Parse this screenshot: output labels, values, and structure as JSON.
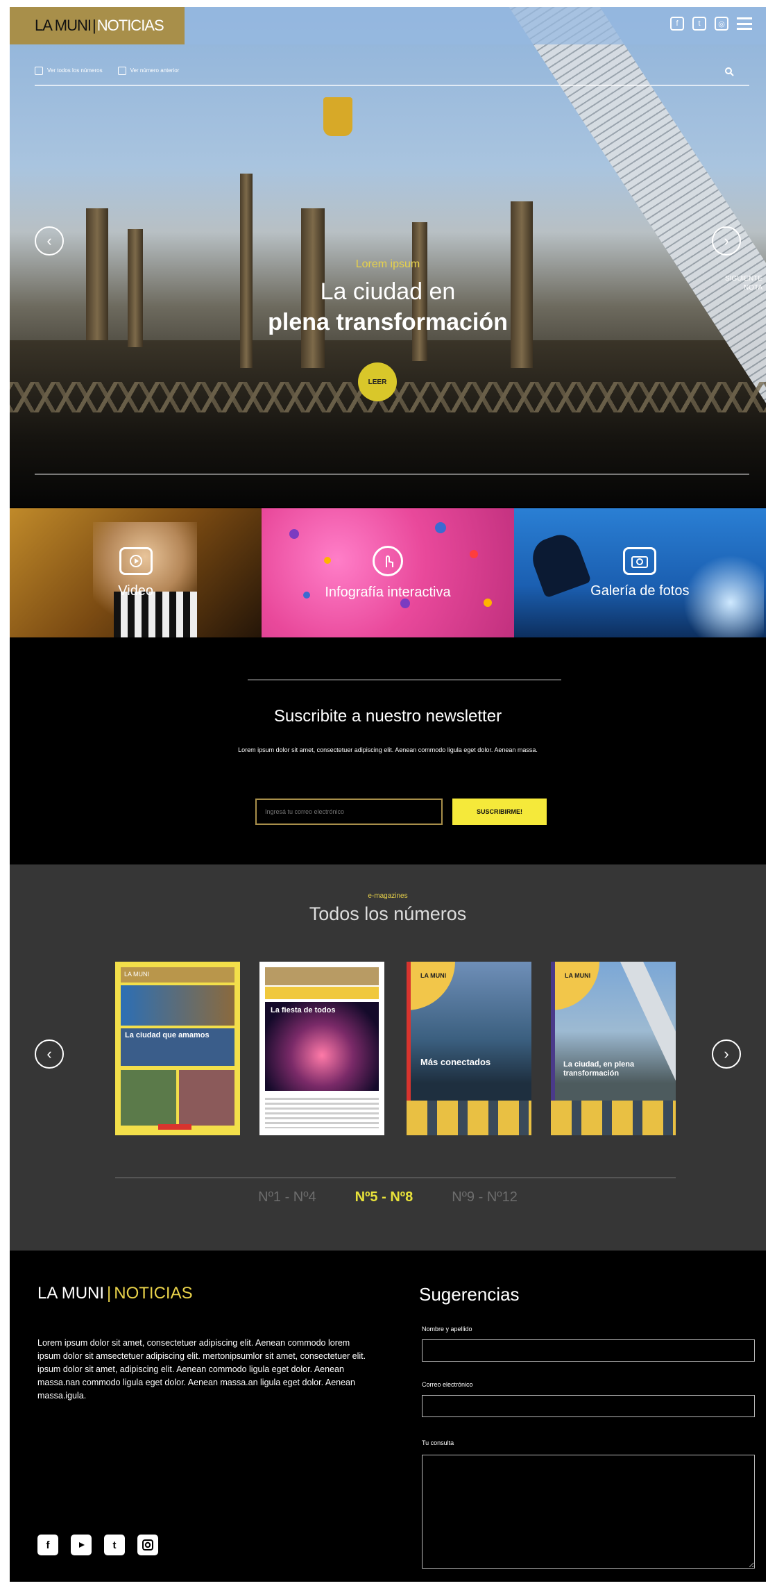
{
  "header": {
    "logo_main": "LA MUNI",
    "logo_sep": "|",
    "logo_sub": "NOTICIAS",
    "subnav": [
      "Ver todos los números",
      "Ver número anterior"
    ]
  },
  "hero": {
    "kicker": "Lorem ipsum",
    "title_line1": "La ciudad en",
    "title_line2": "plena transformación",
    "cta": "LEER",
    "next_label_line1": "SIGUIENTE",
    "next_label_line2": "NOTA"
  },
  "media_tiles": [
    {
      "label": "Video",
      "icon": "play-icon"
    },
    {
      "label": "Infografía interactiva",
      "icon": "touch-icon"
    },
    {
      "label": "Galería de fotos",
      "icon": "camera-icon"
    }
  ],
  "newsletter": {
    "title": "Suscribite a nuestro newsletter",
    "description": "Lorem ipsum dolor sit amet, consectetuer adipiscing elit. Aenean commodo ligula eget dolor. Aenean massa.",
    "input_placeholder": "Ingresá tu correo electrónico",
    "button": "SUSCRIBIRME!"
  },
  "magazines": {
    "kicker": "e-magazines",
    "title": "Todos los números",
    "covers": [
      {
        "headline": "La ciudad que amamos"
      },
      {
        "headline": "La fiesta de todos"
      },
      {
        "headline": "Más conectados"
      },
      {
        "headline": "La ciudad, en plena transformación"
      }
    ],
    "cover_brand": "LA MUNI",
    "pages": [
      "Nº1 - Nº4",
      "Nº5 - Nº8",
      "Nº9 - Nº12"
    ],
    "active_page": "Nº5 - Nº8"
  },
  "footer": {
    "logo_main": "LA MUNI",
    "logo_sep": "|",
    "logo_sub": "NOTICIAS",
    "description": "Lorem ipsum dolor sit amet, consectetuer adipiscing elit. Aenean commodo lorem ipsum dolor sit amsectetuer adipiscing elit. mertonipsumlor sit amet, consectetuer elit. ipsum dolor sit amet, adipiscing elit. Aenean commodo ligula eget dolor. Aenean massa.nan commodo ligula eget dolor. Aenean massa.an ligula eget dolor. Aenean massa.igula.",
    "suggestions_title": "Sugerencias",
    "field_name": "Nombre y apellido",
    "field_email": "Correo electrónico",
    "field_message": "Tu consulta",
    "social_icons": [
      "facebook-icon",
      "youtube-icon",
      "twitter-icon",
      "instagram-icon"
    ]
  },
  "colors": {
    "gold": "#a88f4a",
    "yellow_accent": "#e8e23a",
    "magazine_bg": "#363636",
    "pink_tile": "#e9499b",
    "blue_tile": "#1b5fb1"
  }
}
